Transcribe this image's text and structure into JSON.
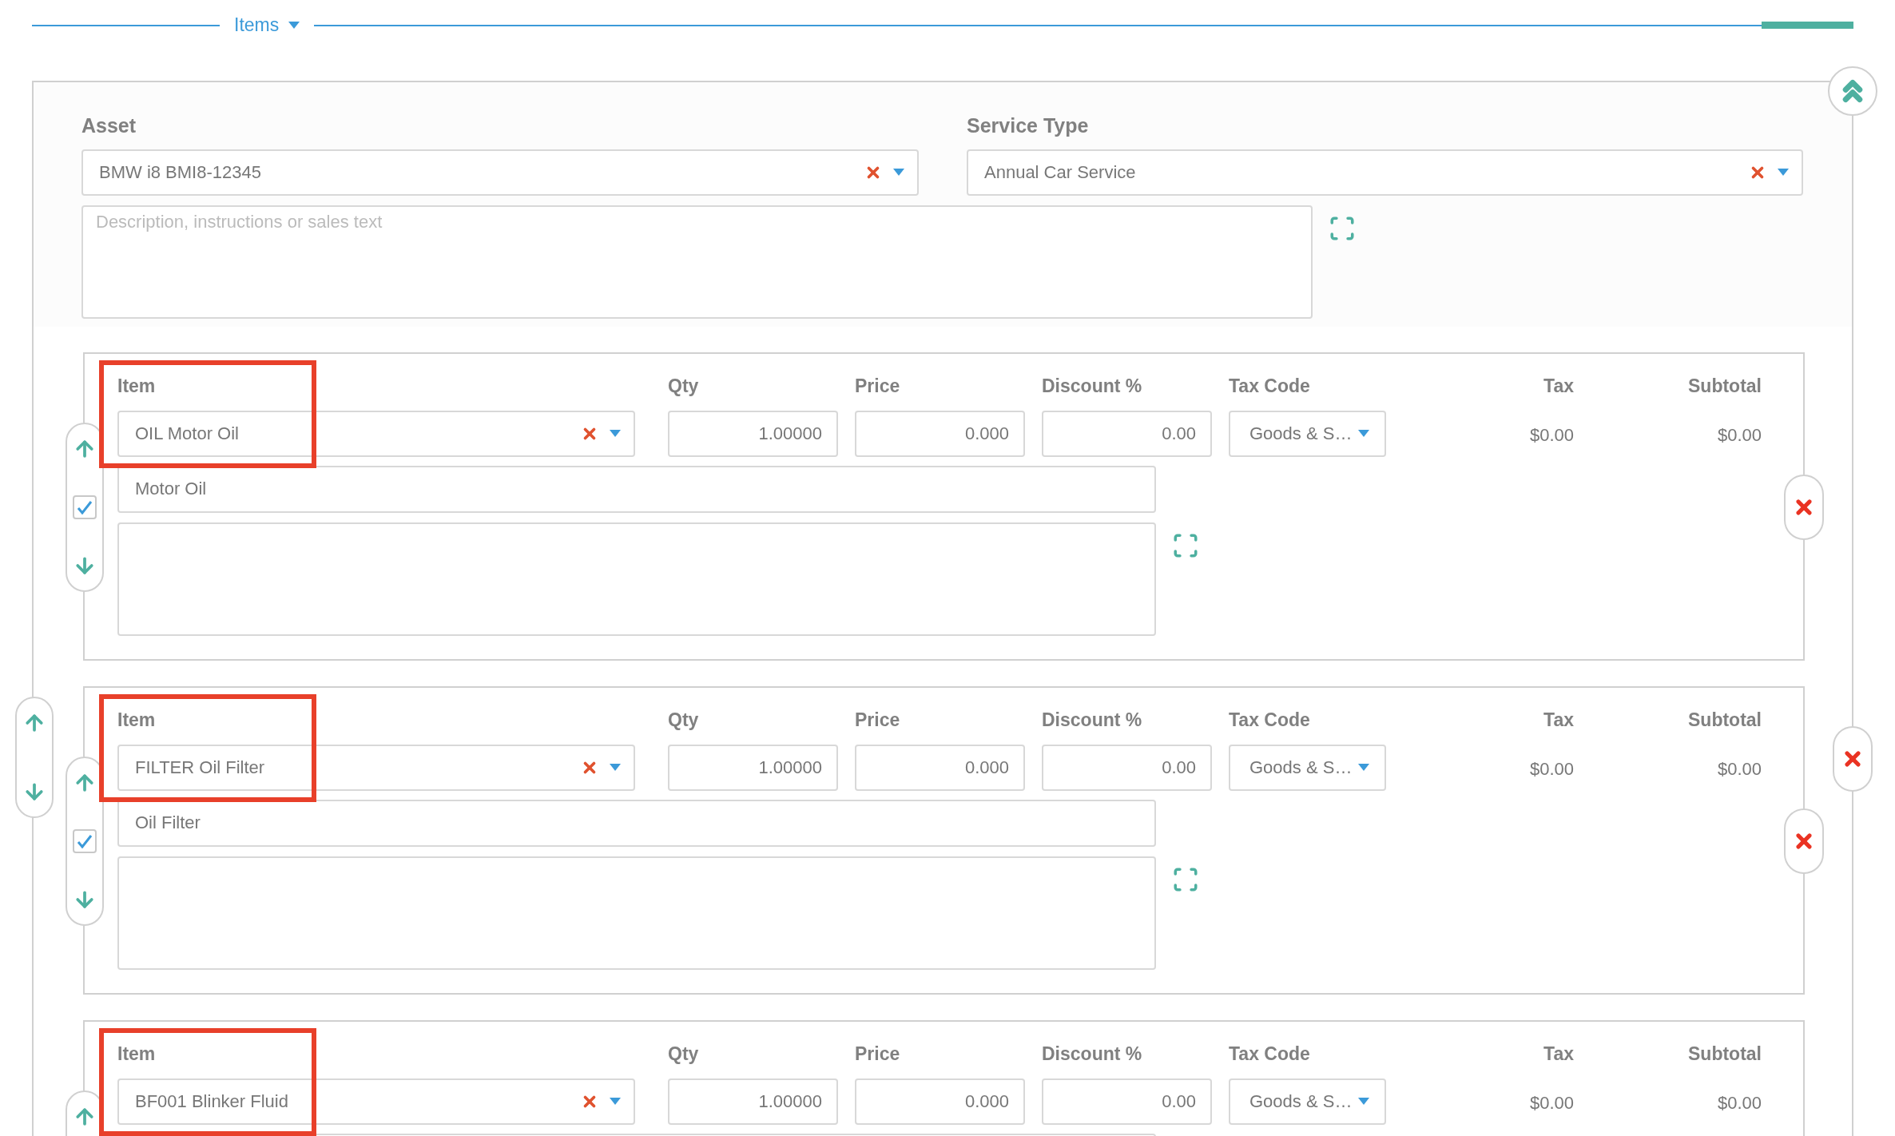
{
  "section": {
    "title": "Items"
  },
  "asset": {
    "label": "Asset",
    "value": "BMW i8 BMI8-12345"
  },
  "service_type": {
    "label": "Service Type",
    "value": "Annual Car Service"
  },
  "description": {
    "placeholder": "Description, instructions or sales text"
  },
  "items": [
    {
      "headers": [
        "Item",
        "Qty",
        "Price",
        "Discount %",
        "Tax Code",
        "Tax",
        "Subtotal"
      ],
      "item": "OIL Motor Oil",
      "qty": "1.00000",
      "price": "0.000",
      "discount": "0.00",
      "tax_code": "Goods & S…",
      "tax": "$0.00",
      "subtotal": "$0.00",
      "description": "Motor Oil",
      "checked": true,
      "highlighted": true,
      "group_controls": false
    },
    {
      "headers": [
        "Item",
        "Qty",
        "Price",
        "Discount %",
        "Tax Code",
        "Tax",
        "Subtotal"
      ],
      "item": "FILTER Oil Filter",
      "qty": "1.00000",
      "price": "0.000",
      "discount": "0.00",
      "tax_code": "Goods & S…",
      "tax": "$0.00",
      "subtotal": "$0.00",
      "description": "Oil Filter",
      "checked": true,
      "highlighted": true,
      "group_controls": true
    },
    {
      "headers": [
        "Item",
        "Qty",
        "Price",
        "Discount %",
        "Tax Code",
        "Tax",
        "Subtotal"
      ],
      "item": "BF001 Blinker Fluid",
      "qty": "1.00000",
      "price": "0.000",
      "discount": "0.00",
      "tax_code": "Goods & S…",
      "tax": "$0.00",
      "subtotal": "$0.00",
      "highlighted": true,
      "group_controls": false
    }
  ]
}
